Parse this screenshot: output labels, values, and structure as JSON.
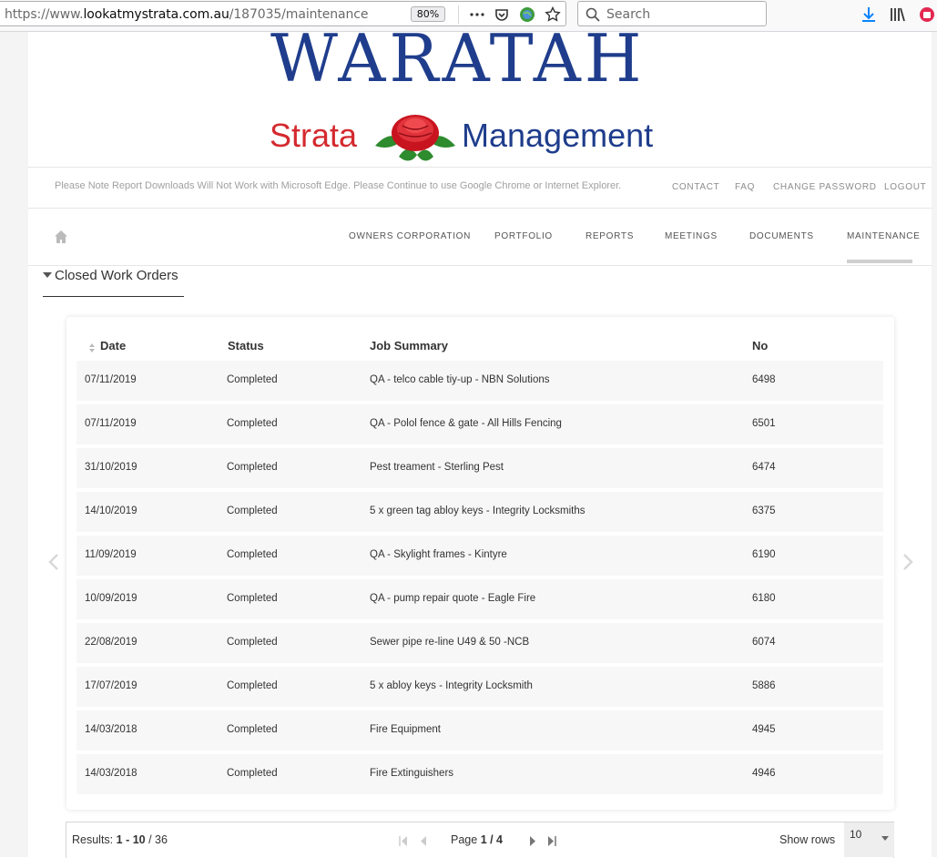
{
  "browser": {
    "url_prefix": "https://www.",
    "url_domain": "lookatmystrata.com.au",
    "url_path": "/187035/maintenance",
    "zoom": "80%",
    "search_placeholder": "Search"
  },
  "logo": {
    "line1": "WARATAH",
    "strata": "Strata",
    "management": "Management"
  },
  "notice": "Please Note Report Downloads Will Not Work with Microsoft Edge. Please Continue to use Google Chrome or Internet Explorer.",
  "top_links": [
    "CONTACT",
    "FAQ",
    "CHANGE PASSWORD",
    "LOGOUT"
  ],
  "nav": [
    "OWNERS CORPORATION",
    "PORTFOLIO",
    "REPORTS",
    "MEETINGS",
    "DOCUMENTS",
    "MAINTENANCE"
  ],
  "section_title": "Closed Work Orders",
  "table": {
    "headers": [
      "Date",
      "Status",
      "Job Summary",
      "No"
    ],
    "rows": [
      [
        "07/11/2019",
        "Completed",
        "QA - telco cable tiy-up - NBN Solutions",
        "6498"
      ],
      [
        "07/11/2019",
        "Completed",
        "QA - Polol fence & gate - All Hills Fencing",
        "6501"
      ],
      [
        "31/10/2019",
        "Completed",
        "Pest treament - Sterling Pest",
        "6474"
      ],
      [
        "14/10/2019",
        "Completed",
        "5 x green tag abloy keys - Integrity Locksmiths",
        "6375"
      ],
      [
        "11/09/2019",
        "Completed",
        "QA - Skylight frames - Kintyre",
        "6190"
      ],
      [
        "10/09/2019",
        "Completed",
        "QA - pump repair quote - Eagle Fire",
        "6180"
      ],
      [
        "22/08/2019",
        "Completed",
        "Sewer pipe re-line U49 & 50 -NCB",
        "6074"
      ],
      [
        "17/07/2019",
        "Completed",
        "5 x abloy keys - Integrity Locksmith",
        "5886"
      ],
      [
        "14/03/2018",
        "Completed",
        "Fire Equipment",
        "4945"
      ],
      [
        "14/03/2018",
        "Completed",
        "Fire Extinguishers",
        "4946"
      ]
    ]
  },
  "pager": {
    "results_label": "Results:",
    "results_range": "1 - 10",
    "results_total": "/ 36",
    "page_label": "Page",
    "page_current": "1 / 4",
    "show_rows_label": "Show rows",
    "show_rows_value": "10"
  }
}
